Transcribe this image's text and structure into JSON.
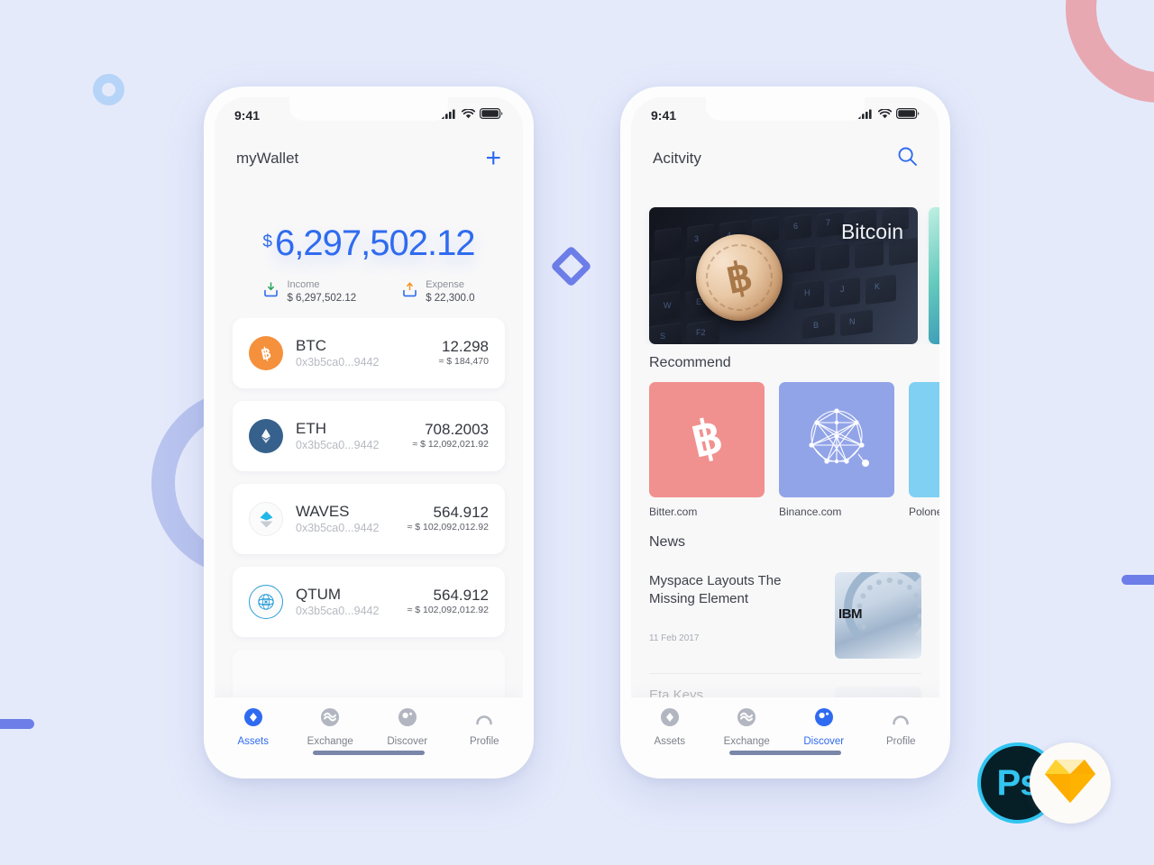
{
  "theme": {
    "background": "#e5eafb",
    "accent": "#2f6bf0",
    "accent_secondary": "#6d7ee8",
    "pink_arc": "#e8a8b2",
    "ring_small": "#b6d4f7",
    "ring_large": "#b9c4ef",
    "text_primary": "#34373f",
    "text_muted": "#8c8f98"
  },
  "decorations": {
    "ring_small": "circle-ring",
    "ring_large": "circle-ring",
    "arc_pink": "arc-shape",
    "diamond": "diamond-outline",
    "dash_left": "rounded-dash",
    "dash_right": "rounded-dash"
  },
  "tool_badges": {
    "photoshop_label": "Ps",
    "photoshop_name": "photoshop-badge",
    "sketch_name": "sketch-badge"
  },
  "wallet_screen": {
    "status": {
      "time": "9:41",
      "signal": "signal-icon",
      "wifi": "wifi-icon",
      "battery": "battery-icon"
    },
    "header": {
      "title": "myWallet",
      "add_label": "+"
    },
    "balance": {
      "currency": "$",
      "amount": "6,297,502.12"
    },
    "flows": [
      {
        "label": "Income",
        "value": "$ 6,297,502.12",
        "icon": "download-tray-icon",
        "arrow_color": "#2aa45c"
      },
      {
        "label": "Expense",
        "value": "$ 22,300.0",
        "icon": "upload-tray-icon",
        "arrow_color": "#f0951e"
      }
    ],
    "assets": [
      {
        "symbol": "BTC",
        "address": "0x3b5ca0...9442",
        "amount": "12.298",
        "fiat": "≈ $ 184,470",
        "icon": "bitcoin-icon",
        "color": "#f5903c"
      },
      {
        "symbol": "ETH",
        "address": "0x3b5ca0...9442",
        "amount": "708.2003",
        "fiat": "≈ $ 12,092,021.92",
        "icon": "ethereum-icon",
        "color": "#35618c"
      },
      {
        "symbol": "WAVES",
        "address": "0x3b5ca0...9442",
        "amount": "564.912",
        "fiat": "≈ $ 102,092,012.92",
        "icon": "waves-icon",
        "color": "#21b8e8"
      },
      {
        "symbol": "QTUM",
        "address": "0x3b5ca0...9442",
        "amount": "564.912",
        "fiat": "≈ $ 102,092,012.92",
        "icon": "qtum-icon",
        "color": "#2a9fd6"
      }
    ],
    "tabs": [
      {
        "label": "Assets",
        "icon": "assets-diamond-icon",
        "active": true
      },
      {
        "label": "Exchange",
        "icon": "exchange-wave-icon",
        "active": false
      },
      {
        "label": "Discover",
        "icon": "discover-compass-icon",
        "active": false
      },
      {
        "label": "Profile",
        "icon": "profile-person-icon",
        "active": false
      }
    ]
  },
  "discover_screen": {
    "status": {
      "time": "9:41",
      "signal": "signal-icon",
      "wifi": "wifi-icon",
      "battery": "battery-icon"
    },
    "header": {
      "title": "Acitvity",
      "search_icon": "search-icon"
    },
    "banners": [
      {
        "caption": "Bitcoin",
        "name": "bitcoin-keyboard-banner"
      },
      {
        "caption": "",
        "name": "aurora-banner"
      }
    ],
    "recommend": {
      "title": "Recommend",
      "items": [
        {
          "label": "Bitter.com",
          "color": "#f1918f",
          "icon": "bitcoin-b-icon"
        },
        {
          "label": "Binance.com",
          "color": "#92a4e8",
          "icon": "polygon-network-icon"
        },
        {
          "label": "Polone",
          "color": "#7fd0f2",
          "icon": "sparkle-icon"
        }
      ]
    },
    "news": {
      "title": "News",
      "items": [
        {
          "headline": "Myspace Layouts The Missing Element",
          "date": "11 Feb 2017",
          "thumb": "ibm-rings-thumb"
        },
        {
          "headline": "Eta Keys",
          "date": "",
          "thumb": "person-avatar-thumb"
        }
      ]
    },
    "tabs": [
      {
        "label": "Assets",
        "icon": "assets-diamond-icon",
        "active": false
      },
      {
        "label": "Exchange",
        "icon": "exchange-wave-icon",
        "active": false
      },
      {
        "label": "Discover",
        "icon": "discover-compass-icon",
        "active": true
      },
      {
        "label": "Profile",
        "icon": "profile-person-icon",
        "active": false
      }
    ]
  }
}
